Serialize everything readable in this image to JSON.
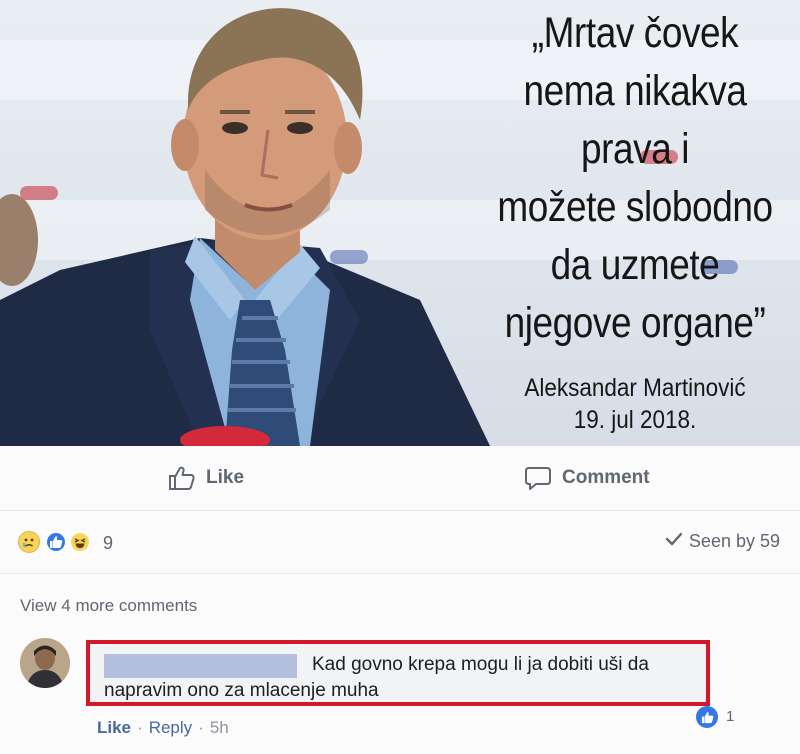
{
  "post": {
    "quote_lines": [
      "„Mrtav čovek",
      "nema nikakva",
      "prava i",
      "možete slobodno",
      "da uzmete",
      "njegove organe”"
    ],
    "author": "Aleksandar Martinović",
    "date": "19. jul 2018."
  },
  "actions": {
    "like_label": "Like",
    "comment_label": "Comment"
  },
  "reactions": {
    "count": "9",
    "seen_label": "Seen by 59",
    "icons": [
      "sad-emoji-icon",
      "like-reaction-icon",
      "haha-emoji-icon"
    ]
  },
  "comments": {
    "view_more": "View 4 more comments",
    "items": [
      {
        "text": "Kad govno krepa mogu li ja dobiti uši da napravim ono za mlacenje muha",
        "like_label": "Like",
        "reply_label": "Reply",
        "time": "5h",
        "like_count": "1"
      }
    ]
  },
  "colors": {
    "highlight_border": "#d4182b",
    "link_blue": "#4b67a1",
    "like_blue": "#3578e5",
    "muted": "#606770"
  }
}
